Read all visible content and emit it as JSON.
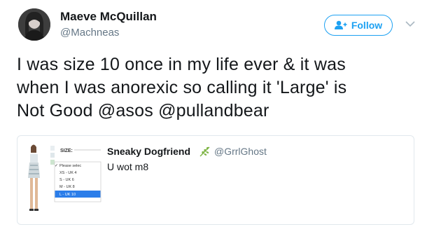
{
  "author": {
    "display_name": "Maeve McQuillan",
    "handle": "@Machneas"
  },
  "follow_button": {
    "label": "Follow"
  },
  "tweet": {
    "lines": [
      "I was size 10 once in my life ever & it was",
      "when I was anorexic so calling it 'Large' is",
      "Not Good @asos @pullandbear"
    ]
  },
  "quoted_tweet": {
    "display_name": "Sneaky Dogfriend",
    "handle": "@GrrlGhost",
    "text": "U wot m8",
    "media": {
      "size_label": "SIZE:",
      "options": [
        "Please selec",
        "XS - UK 4",
        "S - UK 6",
        "M - UK 8",
        "L - UK 10"
      ],
      "selected_option": "L - UK 10"
    }
  },
  "colors": {
    "accent": "#1da1f2",
    "text": "#14171a",
    "secondary": "#657786",
    "border": "#e1e8ed",
    "leaf": "#7cb342"
  },
  "icons": {
    "follow": "add-user-icon",
    "more": "chevron-down-icon",
    "leaf": "leaf-icon"
  }
}
